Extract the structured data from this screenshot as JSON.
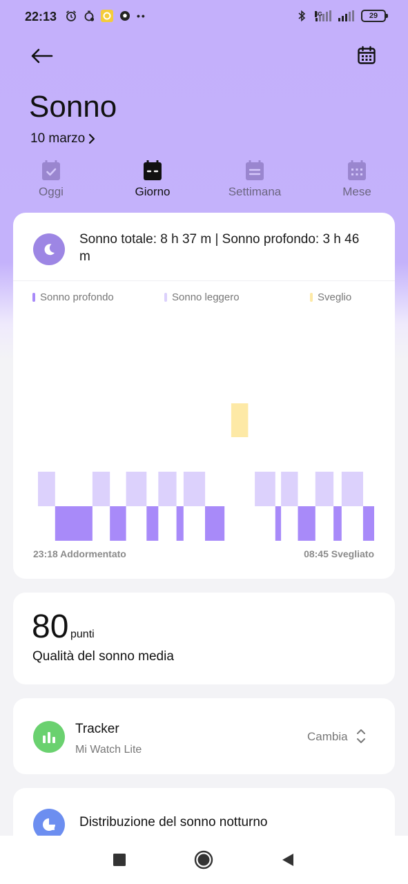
{
  "status_bar": {
    "time": "22:13",
    "network_label": "4G",
    "battery": "29"
  },
  "header": {
    "title": "Sonno",
    "date": "10 marzo"
  },
  "tabs": [
    {
      "label": "Oggi",
      "active": false
    },
    {
      "label": "Giorno",
      "active": true
    },
    {
      "label": "Settimana",
      "active": false
    },
    {
      "label": "Mese",
      "active": false
    }
  ],
  "sleep_card": {
    "summary": "Sonno totale: 8 h 37 m | Sonno profondo: 3 h 46 m",
    "legend": [
      {
        "label": "Sonno profondo",
        "color": "#a88af9"
      },
      {
        "label": "Sonno leggero",
        "color": "#dcd1fc"
      },
      {
        "label": "Sveglio",
        "color": "#fde9a6"
      }
    ],
    "start_label": "23:18 Addormentato",
    "end_label": "08:45 Svegliato"
  },
  "chart_data": {
    "type": "sleep-stage timeline",
    "stages": [
      "Sveglio",
      "Sonno leggero",
      "Sonno profondo"
    ],
    "start": "23:18",
    "end": "08:45",
    "segments": [
      {
        "stage": "Sonno leggero",
        "from": 0.0,
        "to": 0.051
      },
      {
        "stage": "Sonno profondo",
        "from": 0.051,
        "to": 0.162
      },
      {
        "stage": "Sonno leggero",
        "from": 0.162,
        "to": 0.214
      },
      {
        "stage": "Sonno profondo",
        "from": 0.214,
        "to": 0.262
      },
      {
        "stage": "Sonno leggero",
        "from": 0.262,
        "to": 0.323
      },
      {
        "stage": "Sonno profondo",
        "from": 0.323,
        "to": 0.358
      },
      {
        "stage": "Sonno leggero",
        "from": 0.358,
        "to": 0.412
      },
      {
        "stage": "Sonno profondo",
        "from": 0.412,
        "to": 0.433
      },
      {
        "stage": "Sonno leggero",
        "from": 0.433,
        "to": 0.497
      },
      {
        "stage": "Sonno profondo",
        "from": 0.497,
        "to": 0.555
      },
      {
        "stage": "Sveglio",
        "from": 0.555,
        "to": 0.645
      },
      {
        "stage": "Sonno leggero",
        "from": 0.645,
        "to": 0.706
      },
      {
        "stage": "Sonno profondo",
        "from": 0.706,
        "to": 0.723
      },
      {
        "stage": "Sonno leggero",
        "from": 0.723,
        "to": 0.773
      },
      {
        "stage": "Sonno profondo",
        "from": 0.773,
        "to": 0.825
      },
      {
        "stage": "Sonno leggero",
        "from": 0.825,
        "to": 0.879
      },
      {
        "stage": "Sonno profondo",
        "from": 0.879,
        "to": 0.903
      },
      {
        "stage": "Sonno leggero",
        "from": 0.903,
        "to": 0.967
      },
      {
        "stage": "Sonno profondo",
        "from": 0.967,
        "to": 1.0
      }
    ]
  },
  "quality_card": {
    "score": "80",
    "unit": "punti",
    "label": "Qualità del sonno media"
  },
  "tracker_card": {
    "title": "Tracker",
    "device": "Mi Watch Lite",
    "change_label": "Cambia"
  },
  "distribution_card": {
    "title": "Distribuzione del sonno notturno"
  },
  "icons": {
    "back": "arrow-left-icon",
    "calendar": "calendar-icon",
    "moon": "moon-icon",
    "tracker": "bar-chart-icon",
    "distribution": "pie-chart-icon"
  }
}
